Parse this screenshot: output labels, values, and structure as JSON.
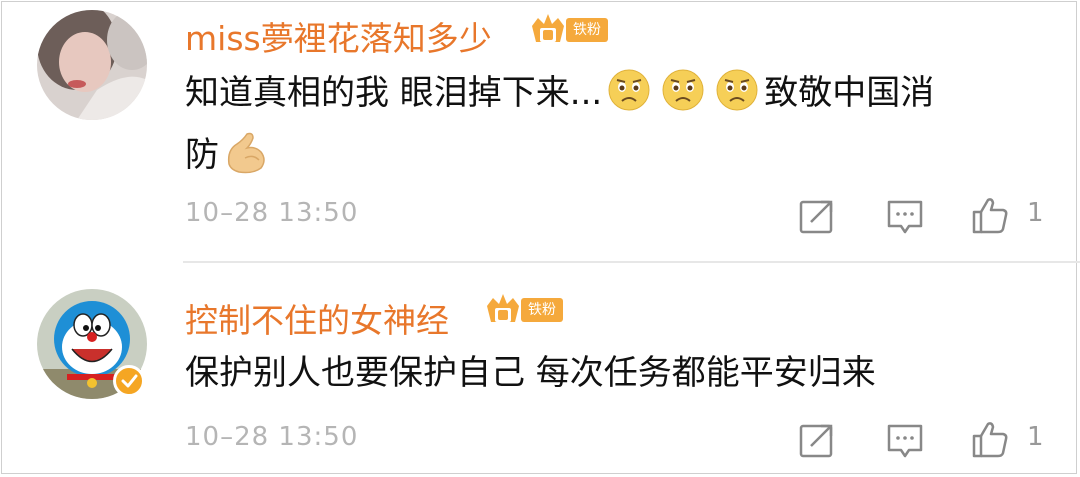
{
  "comments": [
    {
      "username": "miss夢裡花落知多少",
      "badge": "铁粉",
      "text_line1_a": "知道真相的我 眼泪掉下来...",
      "text_line1_b": "致敬中国消",
      "text_line2": "防",
      "emojis": [
        "sad-face-icon",
        "sad-face-icon",
        "sad-face-icon"
      ],
      "time": "10–28 13:50",
      "likes": "1"
    },
    {
      "username": "控制不住的女神经",
      "badge": "铁粉",
      "text_line1": "保护别人也要保护自己  每次任务都能平安归来",
      "time": "10–28 13:50",
      "likes": "1",
      "verified": true
    }
  ],
  "colors": {
    "username": "#e8772b",
    "badge": "#f5a93c",
    "time": "#b5b5b5"
  }
}
